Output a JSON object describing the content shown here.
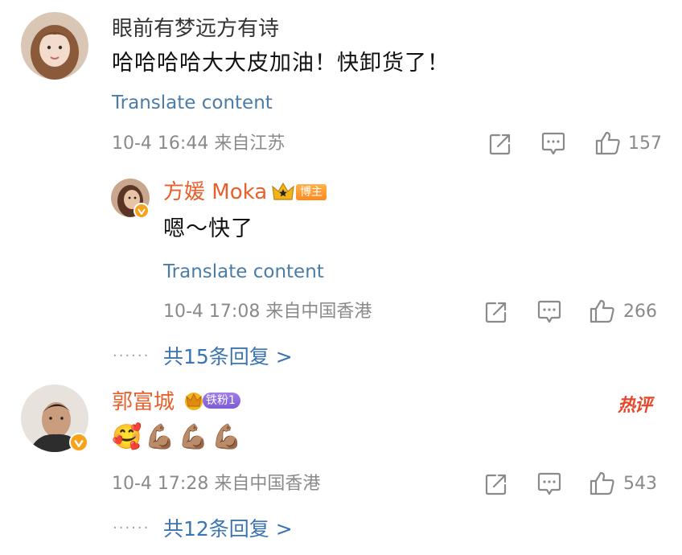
{
  "comments": [
    {
      "username": "眼前有梦远方有诗",
      "text": "哈哈哈哈大大皮加油！快卸货了！",
      "translate": "Translate content",
      "meta": "10-4 16:44 来自江苏",
      "likes": "157",
      "reply": {
        "username": "方媛 Moka",
        "badge": "博主",
        "text": "嗯～快了",
        "translate": "Translate content",
        "meta": "10-4 17:08 来自中国香港",
        "likes": "266"
      },
      "more_replies": "共15条回复 >"
    },
    {
      "username": "郭富城",
      "badge": "铁粉1",
      "hot_label": "热评",
      "text": "🥰💪🏽💪🏽💪🏽",
      "meta": "10-4 17:28 来自中国香港",
      "likes": "543",
      "more_replies": "共12条回复 >"
    }
  ],
  "dots": "······",
  "icons": {
    "share": "share-icon",
    "comment": "comment-icon",
    "like": "thumbs-up-icon",
    "verified": "verified-icon",
    "crown": "crown-icon"
  },
  "colors": {
    "link": "#4a7ca6",
    "vip_name": "#e8602c",
    "meta": "#8a8a8a",
    "replies": "#3b74b2",
    "hot": "#e8472c"
  }
}
